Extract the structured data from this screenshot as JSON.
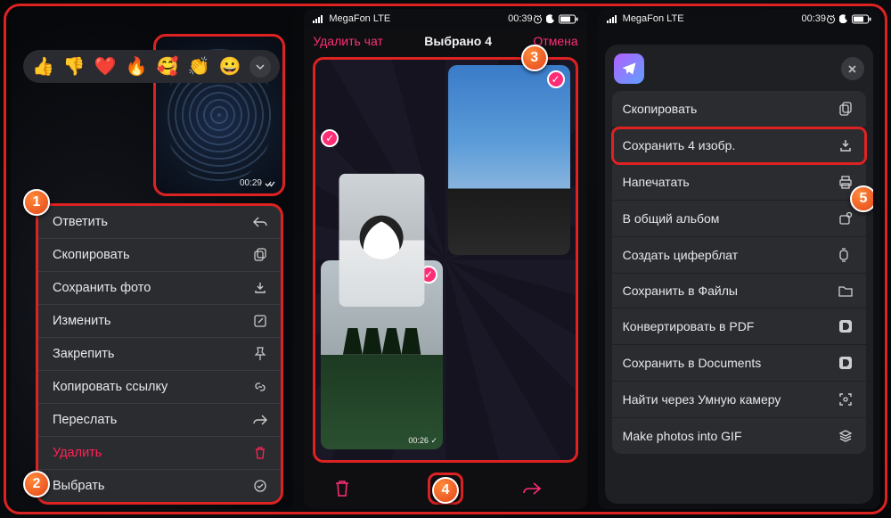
{
  "statusbar": {
    "carrier": "MegaFon  LTE",
    "time": "00:39"
  },
  "badges": {
    "b1": "1",
    "b2": "2",
    "b3": "3",
    "b4": "4",
    "b5": "5"
  },
  "p1": {
    "reactions": [
      "👍",
      "👎",
      "❤️",
      "🔥",
      "🥰",
      "👏",
      "😀"
    ],
    "photo_time": "00:29",
    "menu": [
      {
        "label": "Ответить",
        "icon": "reply",
        "danger": false
      },
      {
        "label": "Скопировать",
        "icon": "copy",
        "danger": false
      },
      {
        "label": "Сохранить фото",
        "icon": "download",
        "danger": false
      },
      {
        "label": "Изменить",
        "icon": "edit",
        "danger": false
      },
      {
        "label": "Закрепить",
        "icon": "pin",
        "danger": false
      },
      {
        "label": "Копировать ссылку",
        "icon": "link",
        "danger": false
      },
      {
        "label": "Переслать",
        "icon": "forward",
        "danger": false
      },
      {
        "label": "Удалить",
        "icon": "trash",
        "danger": true
      },
      {
        "label": "Выбрать",
        "icon": "select",
        "danger": false
      }
    ]
  },
  "p2": {
    "delete_chat": "Удалить чат",
    "title": "Выбрано 4",
    "cancel": "Отмена",
    "forest_time": "00:26"
  },
  "p3": {
    "items": [
      {
        "label": "Скопировать",
        "icon": "copy2"
      },
      {
        "label": "Сохранить 4 изобр.",
        "icon": "save"
      },
      {
        "label": "Напечатать",
        "icon": "print"
      },
      {
        "label": "В общий альбом",
        "icon": "album"
      },
      {
        "label": "Создать циферблат",
        "icon": "watch"
      },
      {
        "label": "Сохранить в Файлы",
        "icon": "folder"
      },
      {
        "label": "Конвертировать в PDF",
        "icon": "d"
      },
      {
        "label": "Сохранить в Documents",
        "icon": "d"
      },
      {
        "label": "Найти через Умную камеру",
        "icon": "scan"
      },
      {
        "label": "Make photos into GIF",
        "icon": "stack"
      }
    ]
  }
}
